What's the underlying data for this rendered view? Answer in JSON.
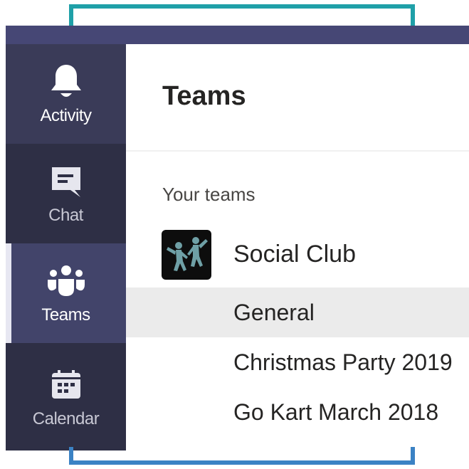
{
  "rail": {
    "items": [
      {
        "label": "Activity",
        "icon": "bell-icon"
      },
      {
        "label": "Chat",
        "icon": "chat-bubble-icon"
      },
      {
        "label": "Teams",
        "icon": "teams-people-icon"
      },
      {
        "label": "Calendar",
        "icon": "calendar-icon"
      }
    ],
    "active": "Teams"
  },
  "panel": {
    "title": "Teams",
    "section_label": "Your teams",
    "team": {
      "name": "Social Club",
      "avatar": "dancing-people-icon",
      "channels": [
        {
          "label": "General",
          "selected": true
        },
        {
          "label": "Christmas Party 2019",
          "selected": false
        },
        {
          "label": "Go Kart March 2018",
          "selected": false
        }
      ]
    }
  },
  "colors": {
    "titlebar": "#464775",
    "rail": "#33344a",
    "rail_active": "#42446a",
    "top_bracket": "#1fa0a8",
    "bottom_bracket": "#3b82c4",
    "selected_channel": "#ebebeb",
    "avatar_figures": "#6fa0a6"
  }
}
